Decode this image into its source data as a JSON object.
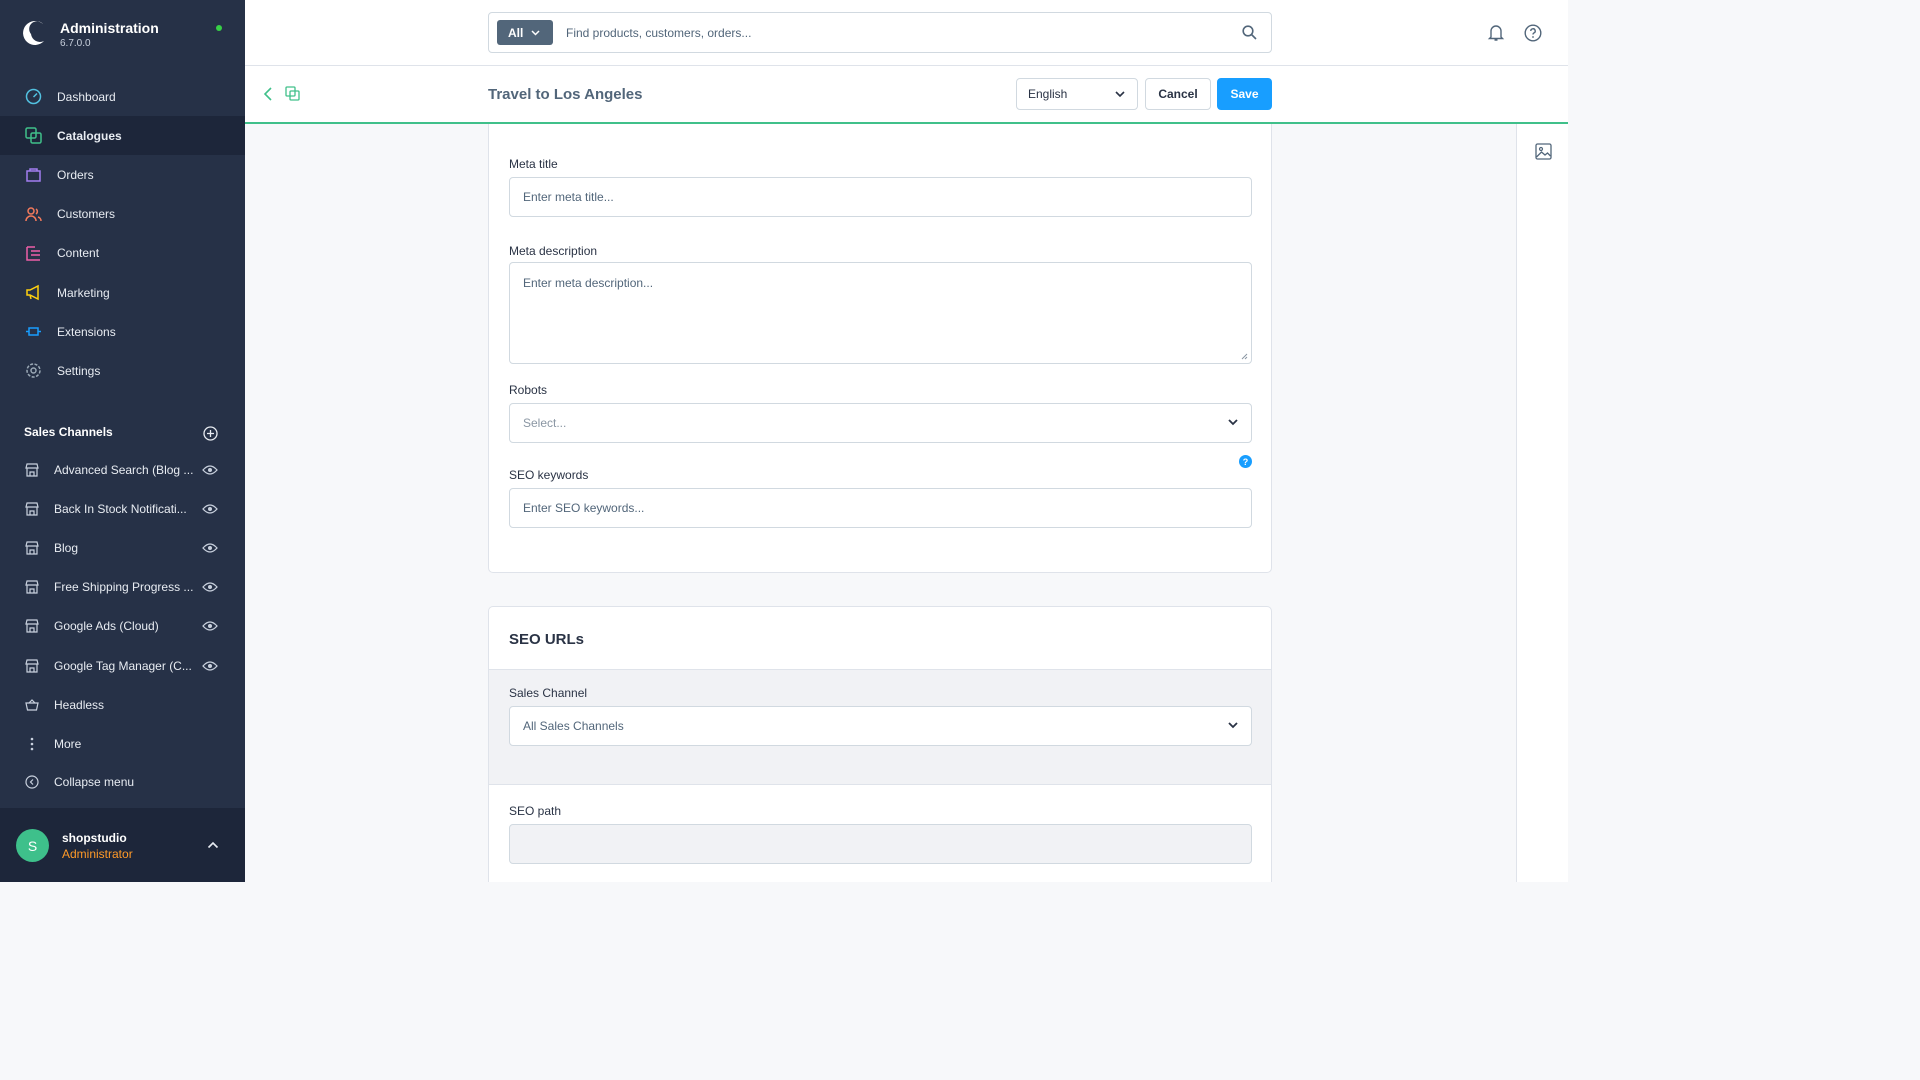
{
  "app": {
    "title": "Administration",
    "version": "6.7.0.0"
  },
  "nav": {
    "items": [
      {
        "label": "Dashboard",
        "icon": "dashboard-icon"
      },
      {
        "label": "Catalogues",
        "icon": "catalogue-icon",
        "active": true
      },
      {
        "label": "Orders",
        "icon": "orders-icon"
      },
      {
        "label": "Customers",
        "icon": "customers-icon"
      },
      {
        "label": "Content",
        "icon": "content-icon"
      },
      {
        "label": "Marketing",
        "icon": "marketing-icon"
      },
      {
        "label": "Extensions",
        "icon": "extensions-icon"
      },
      {
        "label": "Settings",
        "icon": "settings-icon"
      }
    ]
  },
  "sales_channels": {
    "header": "Sales Channels",
    "items": [
      {
        "label": "Advanced Search (Blog ..."
      },
      {
        "label": "Back In Stock Notificati..."
      },
      {
        "label": "Blog"
      },
      {
        "label": "Free Shipping Progress ..."
      },
      {
        "label": "Google Ads (Cloud)"
      },
      {
        "label": "Google Tag Manager (C..."
      },
      {
        "label": "Headless"
      },
      {
        "label": "More"
      },
      {
        "label": "Collapse menu"
      }
    ]
  },
  "user": {
    "initial": "S",
    "name": "shopstudio",
    "role": "Administrator"
  },
  "search": {
    "type_label": "All",
    "placeholder": "Find products, customers, orders..."
  },
  "smartbar": {
    "title": "Travel to Los Angeles",
    "language": "English",
    "cancel_label": "Cancel",
    "save_label": "Save"
  },
  "seo": {
    "meta_title_label": "Meta title",
    "meta_title_placeholder": "Enter meta title...",
    "meta_description_label": "Meta description",
    "meta_description_placeholder": "Enter meta description...",
    "robots_label": "Robots",
    "robots_placeholder": "Select...",
    "keywords_label": "SEO keywords",
    "keywords_placeholder": "Enter SEO keywords..."
  },
  "seo_urls": {
    "title": "SEO URLs",
    "sales_channel_label": "Sales Channel",
    "sales_channel_value": "All Sales Channels",
    "seo_path_label": "SEO path"
  },
  "colors": {
    "sidebar": "#263147",
    "accent_green": "#40c08a",
    "primary_blue": "#189eff",
    "role_orange": "#ff9a28"
  }
}
